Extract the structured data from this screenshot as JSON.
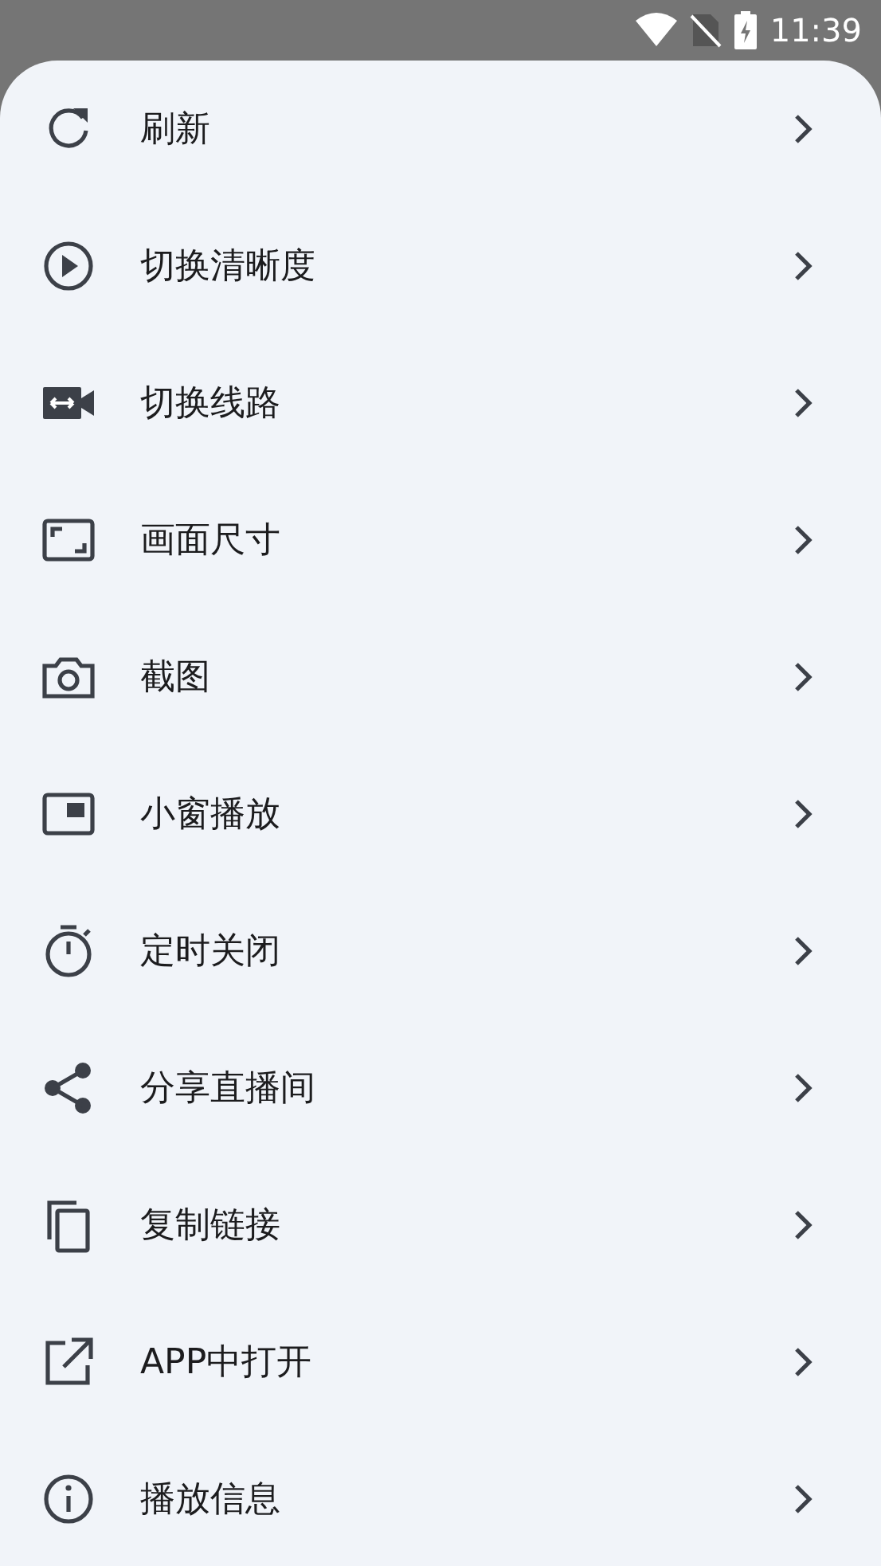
{
  "status_bar": {
    "time": "11:39"
  },
  "menu_items": [
    {
      "label": "刷新"
    },
    {
      "label": "切换清晰度"
    },
    {
      "label": "切换线路"
    },
    {
      "label": "画面尺寸"
    },
    {
      "label": "截图"
    },
    {
      "label": "小窗播放"
    },
    {
      "label": "定时关闭"
    },
    {
      "label": "分享直播间"
    },
    {
      "label": "复制链接"
    },
    {
      "label": "APP中打开"
    },
    {
      "label": "播放信息"
    }
  ]
}
